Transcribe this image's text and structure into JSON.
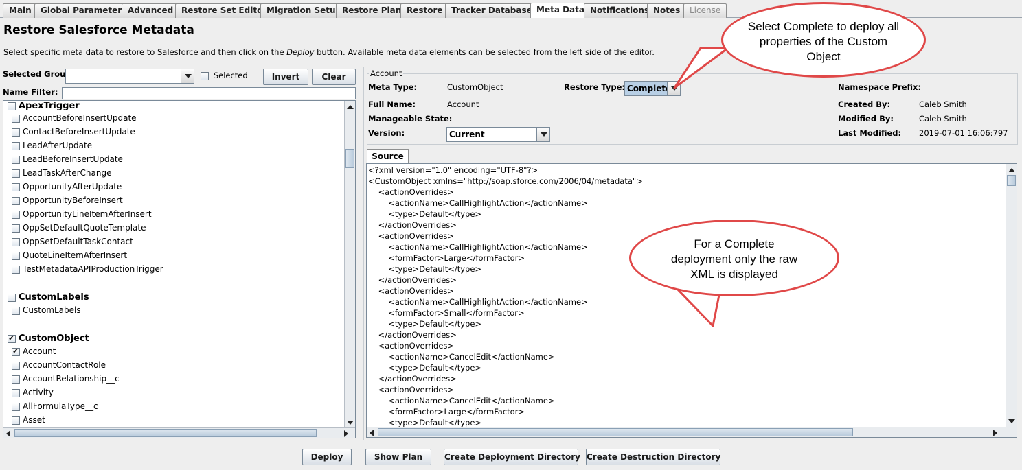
{
  "tabs": [
    "Main",
    "Global Parameters",
    "Advanced",
    "Restore Set Editor",
    "Migration Setup",
    "Restore Plan",
    "Restore",
    "Tracker Database",
    "Meta Data",
    "Notifications",
    "Notes",
    "License"
  ],
  "active_tab": "Meta Data",
  "page": {
    "title": "Restore Salesforce Metadata",
    "desc_before": "Select specific meta data to restore to Salesforce and then click on the ",
    "desc_em": "Deploy",
    "desc_after": " button. Available meta data elements can be selected from the left side of the editor."
  },
  "filters": {
    "selected_group_label": "Selected Group",
    "selected_group_value": "",
    "selected_label": "Selected",
    "invert_label": "Invert",
    "clear_label": "Clear",
    "name_filter_label": "Name Filter:",
    "name_filter_value": ""
  },
  "tree": {
    "apex_group": "ApexTrigger",
    "apex_items": [
      "AccountBeforeInsertUpdate",
      "ContactBeforeInsertUpdate",
      "LeadAfterUpdate",
      "LeadBeforeInsertUpdate",
      "LeadTaskAfterChange",
      "OpportunityAfterUpdate",
      "OpportunityBeforeInsert",
      "OpportunityLineItemAfterInsert",
      "OppSetDefaultQuoteTemplate",
      "OppSetDefaultTaskContact",
      "QuoteLineItemAfterInsert",
      "TestMetadataAPIProductionTrigger"
    ],
    "labels_group": "CustomLabels",
    "labels_items": [
      "CustomLabels"
    ],
    "object_group": "CustomObject",
    "object_items": [
      "Account",
      "AccountContactRole",
      "AccountRelationship__c",
      "Activity",
      "AllFormulaType__c",
      "Asset"
    ]
  },
  "details": {
    "section_title": "Account",
    "meta_type_label": "Meta Type:",
    "meta_type_value": "CustomObject",
    "restore_type_label": "Restore Type:",
    "restore_type_value": "Complete",
    "namespace_label": "Namespace Prefix:",
    "full_name_label": "Full Name:",
    "full_name_value": "Account",
    "created_by_label": "Created By:",
    "created_by_value": "Caleb Smith",
    "manageable_label": "Manageable State:",
    "modified_by_label": "Modified By:",
    "modified_by_value": "Caleb Smith",
    "version_label": "Version:",
    "version_value": "Current",
    "last_modified_label": "Last Modified:",
    "last_modified_value": "2019-07-01 16:06:797"
  },
  "source_tab": "Source",
  "xml_lines": [
    "<?xml version=\"1.0\" encoding=\"UTF-8\"?>",
    "<CustomObject xmlns=\"http://soap.sforce.com/2006/04/metadata\">",
    "    <actionOverrides>",
    "        <actionName>CallHighlightAction</actionName>",
    "        <type>Default</type>",
    "    </actionOverrides>",
    "    <actionOverrides>",
    "        <actionName>CallHighlightAction</actionName>",
    "        <formFactor>Large</formFactor>",
    "        <type>Default</type>",
    "    </actionOverrides>",
    "    <actionOverrides>",
    "        <actionName>CallHighlightAction</actionName>",
    "        <formFactor>Small</formFactor>",
    "        <type>Default</type>",
    "    </actionOverrides>",
    "    <actionOverrides>",
    "        <actionName>CancelEdit</actionName>",
    "        <type>Default</type>",
    "    </actionOverrides>",
    "    <actionOverrides>",
    "        <actionName>CancelEdit</actionName>",
    "        <formFactor>Large</formFactor>",
    "        <type>Default</type>"
  ],
  "buttons": {
    "deploy": "Deploy",
    "show_plan": "Show Plan",
    "create_deployment": "Create Deployment Directory",
    "create_destruction": "Create Destruction Directory"
  },
  "callouts": {
    "top": "Select Complete to deploy all properties of the Custom Object",
    "middle": "For a Complete deployment only the raw XML is displayed"
  },
  "colors": {
    "callout_border": "#e04848",
    "selection_bg": "#b8cfe5"
  }
}
